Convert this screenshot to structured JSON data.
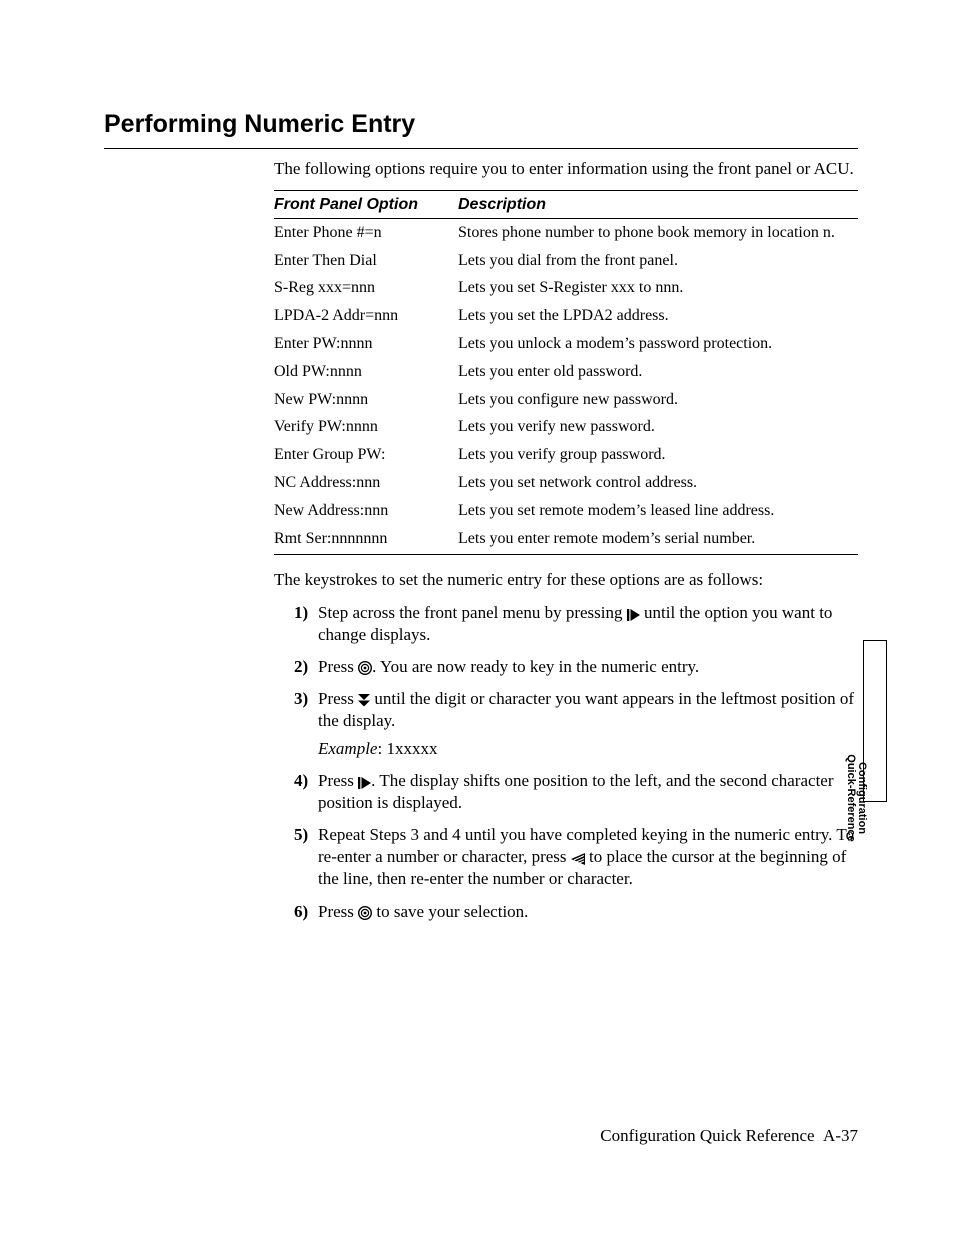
{
  "title": "Performing Numeric Entry",
  "intro": "The following options require you to enter information using the front panel or ACU.",
  "table": {
    "headers": {
      "option": "Front Panel Option",
      "description": "Description"
    },
    "rows": [
      {
        "option": "Enter Phone #=n",
        "description": "Stores phone number to phone book memory in location n."
      },
      {
        "option": "Enter Then Dial",
        "description": "Lets you dial from the front panel."
      },
      {
        "option": "S-Reg xxx=nnn",
        "description": "Lets you set S-Register xxx to nnn."
      },
      {
        "option": "LPDA-2 Addr=nnn",
        "description": "Lets you set the LPDA2 address."
      },
      {
        "option": "Enter PW:nnnn",
        "description": "Lets you unlock a modem’s password protection."
      },
      {
        "option": "Old PW:nnnn",
        "description": "Lets you enter old password."
      },
      {
        "option": "New PW:nnnn",
        "description": "Lets you configure new password."
      },
      {
        "option": "Verify PW:nnnn",
        "description": "Lets you verify new password."
      },
      {
        "option": "Enter Group PW:",
        "description": "Lets you verify group password."
      },
      {
        "option": "NC Address:nnn",
        "description": "Lets you set network control address."
      },
      {
        "option": "New Address:nnn",
        "description": "Lets you set remote modem’s leased line address."
      },
      {
        "option": "Rmt Ser:nnnnnnn",
        "description": "Lets you enter remote modem’s serial number."
      }
    ]
  },
  "after_table": "The keystrokes to set the numeric entry for these options are as follows:",
  "steps": [
    {
      "n": "1)",
      "parts": [
        {
          "t": "text",
          "v": "Step across the front panel menu by pressing "
        },
        {
          "t": "icon",
          "v": "bar-right"
        },
        {
          "t": "text",
          "v": " until the option you want to change displays."
        }
      ]
    },
    {
      "n": "2)",
      "parts": [
        {
          "t": "text",
          "v": "Press "
        },
        {
          "t": "icon",
          "v": "target"
        },
        {
          "t": "text",
          "v": ". You are now ready to key in the numeric entry."
        }
      ]
    },
    {
      "n": "3)",
      "parts": [
        {
          "t": "text",
          "v": "Press "
        },
        {
          "t": "icon",
          "v": "double-down"
        },
        {
          "t": "text",
          "v": " until the digit or character you want appears in the leftmost position of the display."
        }
      ],
      "example_label": "Example",
      "example_value": ": 1xxxxx"
    },
    {
      "n": "4)",
      "parts": [
        {
          "t": "text",
          "v": "Press "
        },
        {
          "t": "icon",
          "v": "bar-right"
        },
        {
          "t": "text",
          "v": ". The display shifts one position to the left, and the second character position is displayed."
        }
      ]
    },
    {
      "n": "5)",
      "parts": [
        {
          "t": "text",
          "v": "Repeat Steps 3 and 4 until you have completed keying in the numeric entry. To re-enter a number or character, press "
        },
        {
          "t": "icon",
          "v": "hatched-left"
        },
        {
          "t": "text",
          "v": " to place the cursor at the beginning of the line, then re-enter the number or character."
        }
      ]
    },
    {
      "n": "6)",
      "parts": [
        {
          "t": "text",
          "v": "Press "
        },
        {
          "t": "icon",
          "v": "target"
        },
        {
          "t": "text",
          "v": " to save your selection."
        }
      ]
    }
  ],
  "side_tab": {
    "line1": "Configuration",
    "line2": "Quick-Reference"
  },
  "footer": {
    "text": "Configuration Quick Reference",
    "page": "A-37"
  }
}
